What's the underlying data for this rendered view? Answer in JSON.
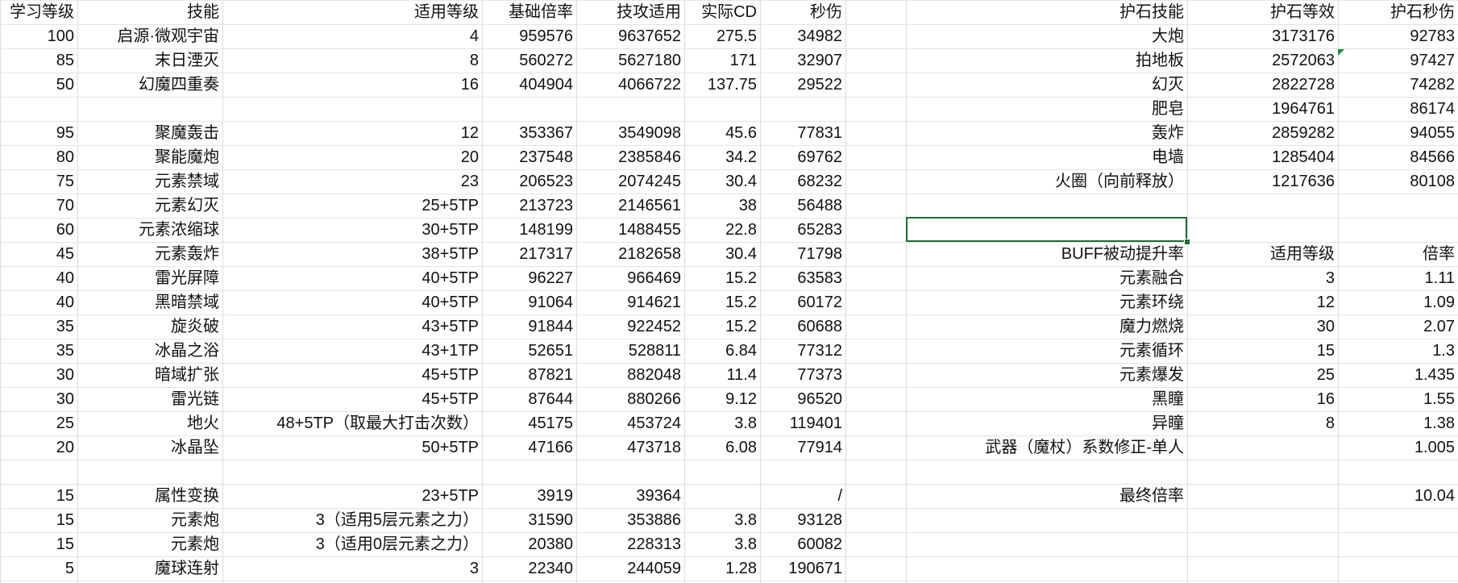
{
  "colors": {
    "grid": "#dcdcdc",
    "selection": "#1e6b37",
    "comment_marker": "#1e8c3a"
  },
  "left_table": {
    "headers": [
      "学习等级",
      "技能",
      "适用等级",
      "基础倍率",
      "技攻适用",
      "实际CD",
      "秒伤"
    ],
    "rows": [
      [
        "100",
        "启源·微观宇宙",
        "4",
        "959576",
        "9637652",
        "275.5",
        "34982"
      ],
      [
        "85",
        "末日湮灭",
        "8",
        "560272",
        "5627180",
        "171",
        "32907"
      ],
      [
        "50",
        "幻魔四重奏",
        "16",
        "404904",
        "4066722",
        "137.75",
        "29522"
      ],
      [
        "",
        "",
        "",
        "",
        "",
        "",
        ""
      ],
      [
        "95",
        "聚魔轰击",
        "12",
        "353367",
        "3549098",
        "45.6",
        "77831"
      ],
      [
        "80",
        "聚能魔炮",
        "20",
        "237548",
        "2385846",
        "34.2",
        "69762"
      ],
      [
        "75",
        "元素禁域",
        "23",
        "206523",
        "2074245",
        "30.4",
        "68232"
      ],
      [
        "70",
        "元素幻灭",
        "25+5TP",
        "213723",
        "2146561",
        "38",
        "56488"
      ],
      [
        "60",
        "元素浓缩球",
        "30+5TP",
        "148199",
        "1488455",
        "22.8",
        "65283"
      ],
      [
        "45",
        "元素轰炸",
        "38+5TP",
        "217317",
        "2182658",
        "30.4",
        "71798"
      ],
      [
        "40",
        "雷光屏障",
        "40+5TP",
        "96227",
        "966469",
        "15.2",
        "63583"
      ],
      [
        "40",
        "黑暗禁域",
        "40+5TP",
        "91064",
        "914621",
        "15.2",
        "60172"
      ],
      [
        "35",
        "旋炎破",
        "43+5TP",
        "91844",
        "922452",
        "15.2",
        "60688"
      ],
      [
        "35",
        "冰晶之浴",
        "43+1TP",
        "52651",
        "528811",
        "6.84",
        "77312"
      ],
      [
        "30",
        "暗域扩张",
        "45+5TP",
        "87821",
        "882048",
        "11.4",
        "77373"
      ],
      [
        "30",
        "雷光链",
        "45+5TP",
        "87644",
        "880266",
        "9.12",
        "96520"
      ],
      [
        "25",
        "地火",
        "48+5TP（取最大打击次数）",
        "45175",
        "453724",
        "3.8",
        "119401"
      ],
      [
        "20",
        "冰晶坠",
        "50+5TP",
        "47166",
        "473718",
        "6.08",
        "77914"
      ],
      [
        "",
        "",
        "",
        "",
        "",
        "",
        ""
      ],
      [
        "15",
        "属性变换",
        "23+5TP",
        "3919",
        "39364",
        "",
        "/"
      ],
      [
        "15",
        "元素炮",
        "3（适用5层元素之力）",
        "31590",
        "353886",
        "3.8",
        "93128"
      ],
      [
        "15",
        "元素炮",
        "3（适用0层元素之力）",
        "20380",
        "228313",
        "3.8",
        "60082"
      ],
      [
        "5",
        "魔球连射",
        "3",
        "22340",
        "244059",
        "1.28",
        "190671"
      ]
    ]
  },
  "right_table": {
    "headers": [
      "护石技能",
      "护石等效",
      "护石秒伤"
    ],
    "rows": [
      [
        "大炮",
        "3173176",
        "92783"
      ],
      [
        "拍地板",
        "2572063",
        "97427"
      ],
      [
        "幻灭",
        "2822728",
        "74282"
      ],
      [
        "肥皂",
        "1964761",
        "86174"
      ],
      [
        "轰炸",
        "2859282",
        "94055"
      ],
      [
        "电墙",
        "1285404",
        "84566"
      ],
      [
        "火圈（向前释放）",
        "1217636",
        "80108"
      ]
    ]
  },
  "buff_table": {
    "headers": [
      "BUFF被动提升率",
      "适用等级",
      "倍率"
    ],
    "rows": [
      [
        "元素融合",
        "3",
        "1.11"
      ],
      [
        "元素环绕",
        "12",
        "1.09"
      ],
      [
        "魔力燃烧",
        "30",
        "2.07"
      ],
      [
        "元素循环",
        "15",
        "1.3"
      ],
      [
        "元素爆发",
        "25",
        "1.435"
      ],
      [
        "黑瞳",
        "16",
        "1.55"
      ],
      [
        "异瞳",
        "8",
        "1.38"
      ],
      [
        "武器（魔杖）系数修正-单人",
        "",
        "1.005"
      ]
    ],
    "final_label": "最终倍率",
    "final_value": "10.04"
  }
}
